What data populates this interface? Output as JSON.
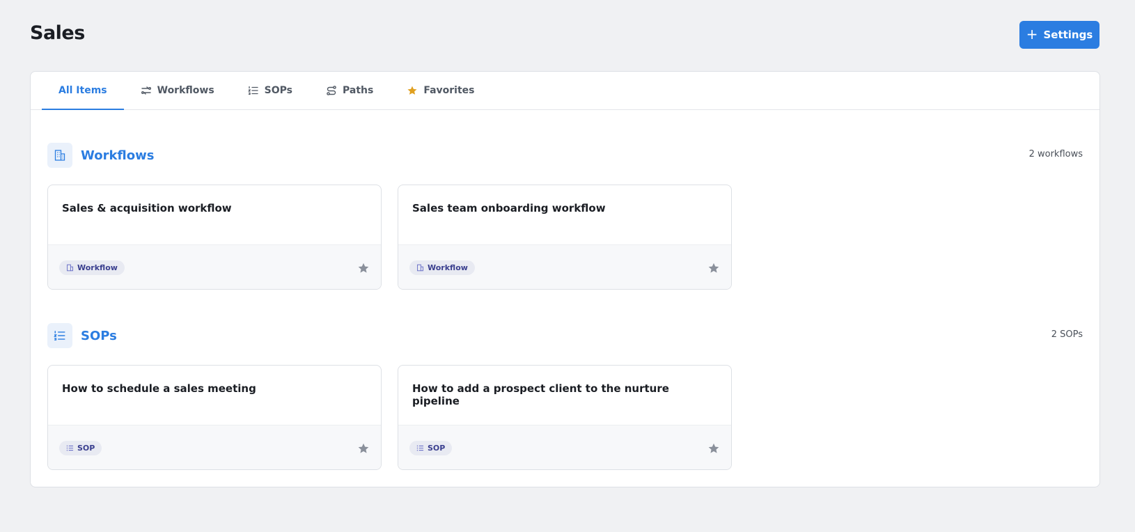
{
  "header": {
    "title": "Sales",
    "settings_label": "Settings",
    "settings_icon": "plus-icon"
  },
  "tabs": [
    {
      "label": "All Items",
      "icon": "none",
      "active": true
    },
    {
      "label": "Workflows",
      "icon": "workflow-icon"
    },
    {
      "label": "SOPs",
      "icon": "list-icon"
    },
    {
      "label": "Paths",
      "icon": "path-icon"
    },
    {
      "label": "Favorites",
      "icon": "star-icon"
    }
  ],
  "sections": {
    "workflows": {
      "title": "Workflows",
      "count": "2 workflows",
      "icon": "building-icon",
      "cards": [
        {
          "title": "Sales & acquisition workflow",
          "badge": "Workflow"
        },
        {
          "title": "Sales team onboarding workflow",
          "badge": "Workflow"
        }
      ]
    },
    "sops": {
      "title": "SOPs",
      "count": "2 SOPs",
      "icon": "list-icon",
      "cards": [
        {
          "title": "How to schedule a sales meeting",
          "badge": "SOP"
        },
        {
          "title": "How to add a prospect client to the nurture pipeline",
          "badge": "SOP"
        }
      ]
    }
  },
  "colors": {
    "accent": "#2b7de1",
    "background": "#f0f1f3",
    "favorite_star": "#e0a020",
    "card_star": "#8a909b"
  }
}
